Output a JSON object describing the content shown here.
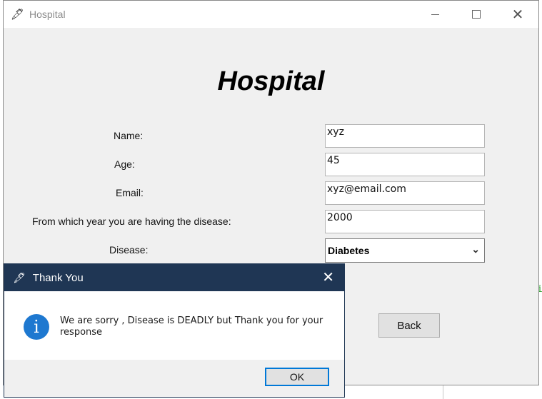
{
  "window": {
    "title": "Hospital",
    "icon": "feather-icon"
  },
  "app_title": "Hospital",
  "form": {
    "name_label": "Name:",
    "name_value": "xyz",
    "age_label": "Age:",
    "age_value": "45",
    "email_label": "Email:",
    "email_value": "xyz@email.com",
    "year_label": "From which year you are having the disease:",
    "year_value": "2000",
    "disease_label": "Disease:",
    "disease_value": "Diabetes",
    "back_label": "Back"
  },
  "dialog": {
    "title": "Thank You",
    "message": "We are sorry , Disease is DEADLY but Thank you for your response",
    "ok_label": "OK"
  },
  "colors": {
    "dialog_titlebar": "#1f3654",
    "info_icon": "#1e78d0",
    "ok_focus_border": "#0078d7"
  }
}
